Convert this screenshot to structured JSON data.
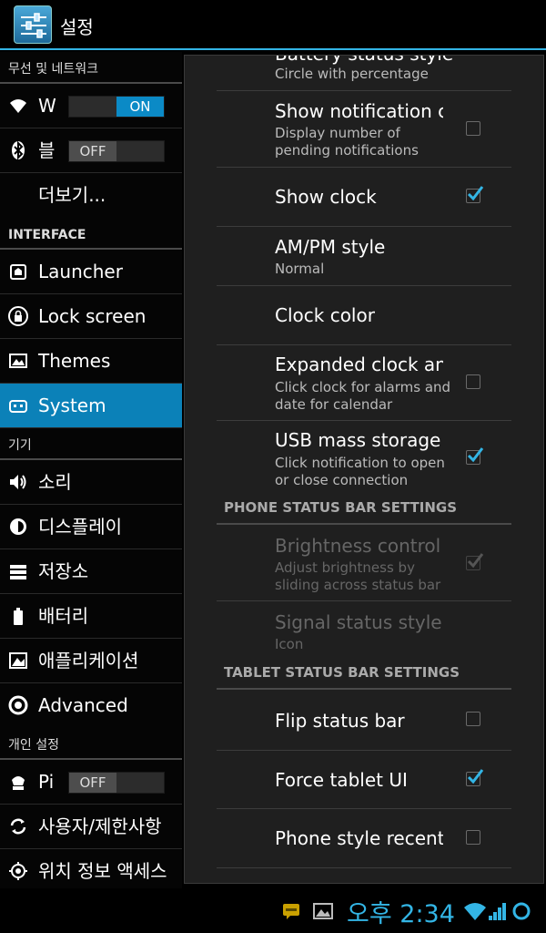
{
  "app": {
    "title": "설정",
    "icon": "settings-sliders-icon",
    "accent": "#33b5e5"
  },
  "sidebar": {
    "header_wireless": "무선 및 네트워크",
    "wifi": {
      "label": "W",
      "icon": "wifi-icon",
      "toggle": "ON"
    },
    "bluetooth": {
      "label": "블",
      "icon": "bluetooth-icon",
      "toggle": "OFF"
    },
    "more": {
      "label": "더보기..."
    },
    "header_interface": "INTERFACE",
    "interface_items": [
      {
        "label": "Launcher",
        "icon": "launcher-icon"
      },
      {
        "label": "Lock screen",
        "icon": "lock-icon"
      },
      {
        "label": "Themes",
        "icon": "themes-icon"
      },
      {
        "label": "System",
        "icon": "system-icon",
        "selected": true
      }
    ],
    "header_device": "기기",
    "device_items": [
      {
        "label": "소리",
        "icon": "volume-icon"
      },
      {
        "label": "디스플레이",
        "icon": "brightness-icon"
      },
      {
        "label": "저장소",
        "icon": "storage-icon"
      },
      {
        "label": "배터리",
        "icon": "battery-icon"
      },
      {
        "label": "애플리케이션",
        "icon": "apps-icon"
      },
      {
        "label": "Advanced",
        "icon": "advanced-icon"
      }
    ],
    "header_personal": "개인 설정",
    "personal": {
      "label": "Pi",
      "icon": "privacy-icon",
      "toggle": "OFF"
    },
    "personal_items": [
      {
        "label": "사용자/제한사항",
        "icon": "sync-icon"
      },
      {
        "label": "위치 정보 액세스",
        "icon": "location-icon"
      }
    ]
  },
  "prefs": {
    "battery_style": {
      "title": "Battery status style",
      "summary": "Circle with percentage"
    },
    "show_notif_count": {
      "title": "Show notification count",
      "summary1": "Display number of",
      "summary2": "pending notifications",
      "checked": false
    },
    "show_clock": {
      "title": "Show clock",
      "checked": true
    },
    "ampm": {
      "title": "AM/PM style",
      "summary": "Normal"
    },
    "clock_color": {
      "title": "Clock color"
    },
    "expanded_clock": {
      "title": "Expanded clock and date",
      "summary1": "Click clock for alarms and",
      "summary2": "date for calendar",
      "checked": false
    },
    "usb_mass": {
      "title": "USB mass storage notification",
      "summary1": "Click notification to open",
      "summary2": "or close connection",
      "checked": true
    },
    "cat_phone": "PHONE STATUS BAR SETTINGS",
    "brightness": {
      "title": "Brightness control",
      "summary1": "Adjust brightness by",
      "summary2": "sliding across status bar",
      "checked": true,
      "disabled": true
    },
    "signal": {
      "title": "Signal status style",
      "summary": "Icon",
      "disabled": true
    },
    "cat_tablet": "TABLET STATUS BAR SETTINGS",
    "flip": {
      "title": "Flip status bar",
      "checked": false
    },
    "force_tablet": {
      "title": "Force tablet UI",
      "checked": true
    },
    "phone_recents": {
      "title": "Phone style recent apps",
      "checked": false
    }
  },
  "statusbar": {
    "time": "오후 2:34",
    "icons": [
      "chat-icon",
      "gallery-icon",
      "wifi-icon",
      "signal-icon",
      "sync-circle-icon"
    ]
  }
}
